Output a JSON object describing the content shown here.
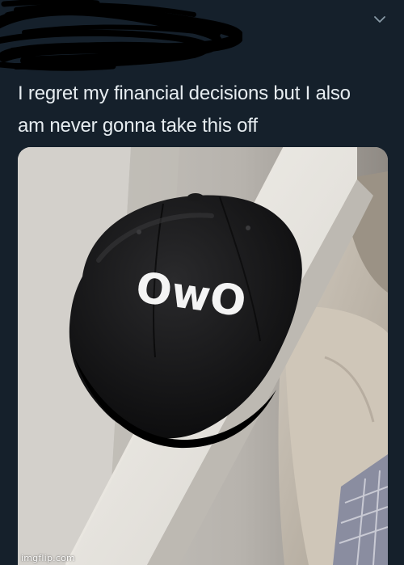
{
  "tweet": {
    "text_line_1": "I regret my financial decisions but I also",
    "text_line_2": "am never gonna take this off"
  },
  "photo": {
    "hat_text": "OwO"
  },
  "header": {
    "menu_icon": "chevron-down-icon"
  },
  "watermark": {
    "text": "imgflip.com"
  },
  "colors": {
    "background": "#15202b",
    "text": "#e6ecf0",
    "icon": "#8899a6"
  }
}
